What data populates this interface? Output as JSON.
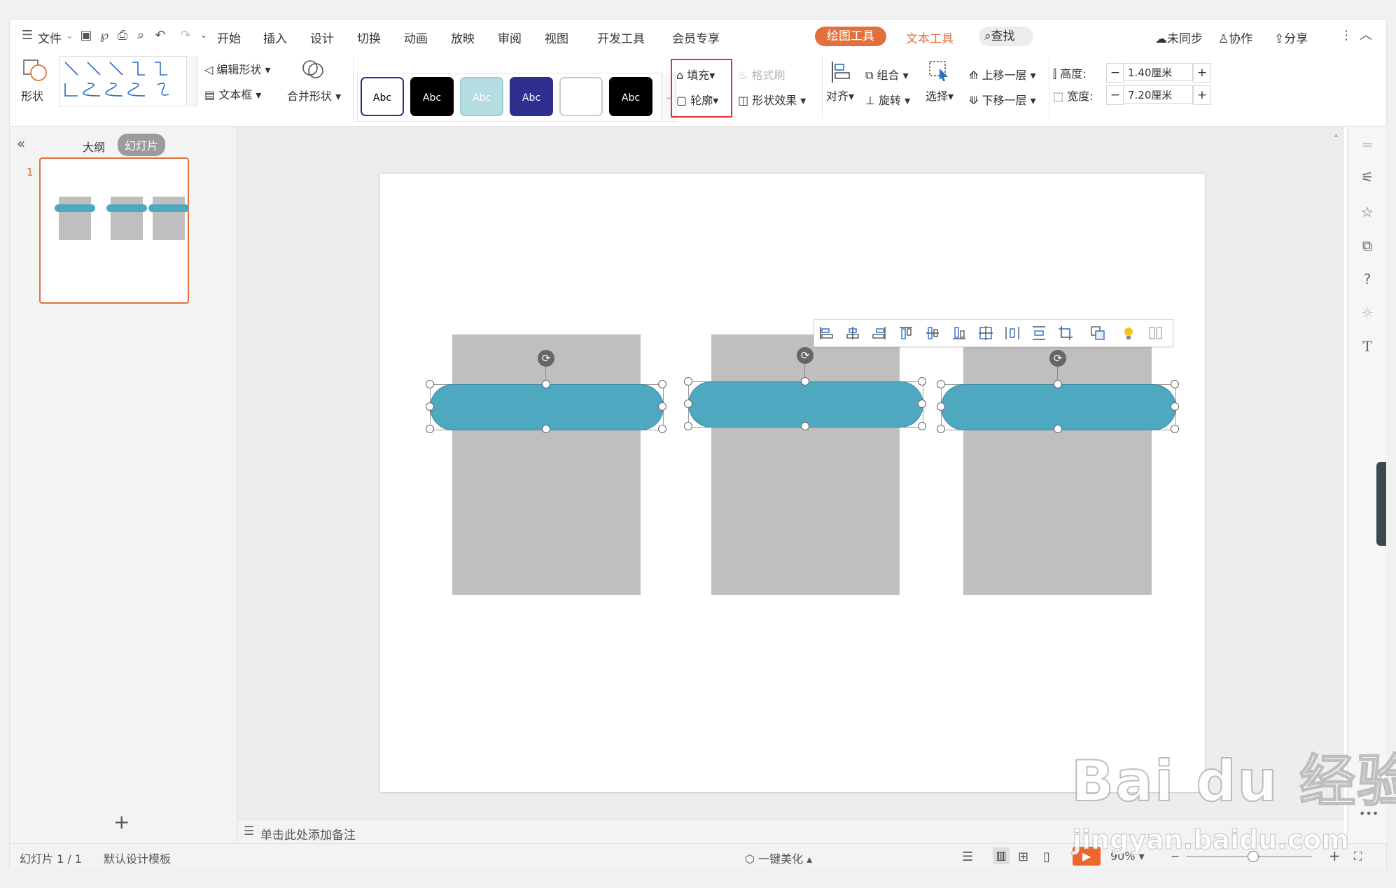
{
  "menu": {
    "file": "文件",
    "tabs": [
      "开始",
      "插入",
      "设计",
      "切换",
      "动画",
      "放映",
      "审阅",
      "视图",
      "开发工具",
      "会员专享"
    ],
    "drawing_tools": "绘图工具",
    "text_tools": "文本工具",
    "search": "查找",
    "right": {
      "sync": "未同步",
      "collab": "协作",
      "share": "分享"
    }
  },
  "ribbon": {
    "shape": "形状",
    "edit_shape": "编辑形状",
    "textbox": "文本框",
    "merge_shape": "合并形状",
    "styles": [
      {
        "label": "Abc",
        "bg": "#ffffff",
        "fg": "#000000",
        "border": "#2e2e8a"
      },
      {
        "label": "Abc",
        "bg": "#000000",
        "fg": "#ffffff",
        "border": "#000000"
      },
      {
        "label": "Abc",
        "bg": "#b4dde2",
        "fg": "#ffffff",
        "border": "#9fcfd6"
      },
      {
        "label": "Abc",
        "bg": "#2f2f8e",
        "fg": "#ffffff",
        "border": "#2f2f8e"
      },
      {
        "label": "",
        "bg": "#ffffff",
        "fg": "#000000",
        "border": "#cccccc"
      },
      {
        "label": "Abc",
        "bg": "#000000",
        "fg": "#ffffff",
        "border": "#000000"
      }
    ],
    "fill": "填充",
    "outline": "轮廓",
    "format_painter": "格式刷",
    "shape_effect": "形状效果",
    "align": "对齐",
    "group": "组合",
    "rotate": "旋转",
    "select": "选择",
    "bring_forward": "上移一层",
    "send_backward": "下移一层",
    "height_label": "高度:",
    "height_value": "1.40厘米",
    "width_label": "宽度:",
    "width_value": "7.20厘米"
  },
  "left_panel": {
    "outline_tab": "大纲",
    "slides_tab": "幻灯片",
    "slide_number": "1"
  },
  "notes_placeholder": "单击此处添加备注",
  "status": {
    "slide_count": "幻灯片 1 / 1",
    "template": "默认设计模板",
    "beautify": "一键美化",
    "zoom": "90%"
  },
  "watermark": {
    "logo": "Bai du 经验",
    "url": "jingyan.baidu.com"
  },
  "colors": {
    "accent": "#e2703a",
    "shape_teal": "#4ea8bf",
    "rect_gray": "#bfbfbf",
    "highlight": "#e23333"
  }
}
